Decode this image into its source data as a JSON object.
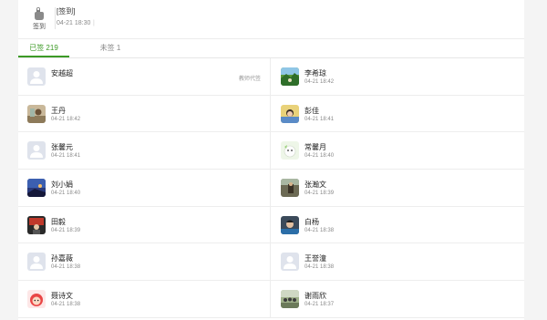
{
  "header": {
    "checkin_label": "签到",
    "title": "[签到]",
    "time": "04-21 18:30",
    "separator": "|"
  },
  "tabs": [
    {
      "label": "已签 219",
      "active": true
    },
    {
      "label": "未签 1",
      "active": false
    }
  ],
  "colors": {
    "accent": "#3c9a26"
  },
  "rows": [
    {
      "left": {
        "name": "安越超",
        "time": "",
        "badge": "教师代签",
        "avatar": "default-avatar"
      },
      "right": {
        "name": "李希琼",
        "time": "04-21 18:42",
        "avatar": "landscape-avatar"
      }
    },
    {
      "left": {
        "name": "王丹",
        "time": "04-21 18:42",
        "avatar": "photo-avatar"
      },
      "right": {
        "name": "彭佳",
        "time": "04-21 18:41",
        "avatar": "portrait-avatar"
      }
    },
    {
      "left": {
        "name": "张馨元",
        "time": "04-21 18:41",
        "avatar": "default-avatar"
      },
      "right": {
        "name": "常馨月",
        "time": "04-21 18:40",
        "avatar": "cartoon-avatar"
      }
    },
    {
      "left": {
        "name": "刘小娟",
        "time": "04-21 18:40",
        "avatar": "sunset-avatar"
      },
      "right": {
        "name": "张瀚文",
        "time": "04-21 18:39",
        "avatar": "scene-avatar"
      }
    },
    {
      "left": {
        "name": "田毅",
        "time": "04-21 18:39",
        "avatar": "figure-avatar"
      },
      "right": {
        "name": "白杨",
        "time": "04-21 18:38",
        "avatar": "person-avatar"
      }
    },
    {
      "left": {
        "name": "孙嘉薇",
        "time": "04-21 18:38",
        "avatar": "default-avatar"
      },
      "right": {
        "name": "王誉潼",
        "time": "04-21 18:38",
        "avatar": "default-avatar"
      }
    },
    {
      "left": {
        "name": "聂诗文",
        "time": "04-21 18:38",
        "avatar": "cartoon-red-avatar"
      },
      "right": {
        "name": "谢雨欣",
        "time": "04-21 18:37",
        "avatar": "group-photo-avatar"
      }
    }
  ]
}
